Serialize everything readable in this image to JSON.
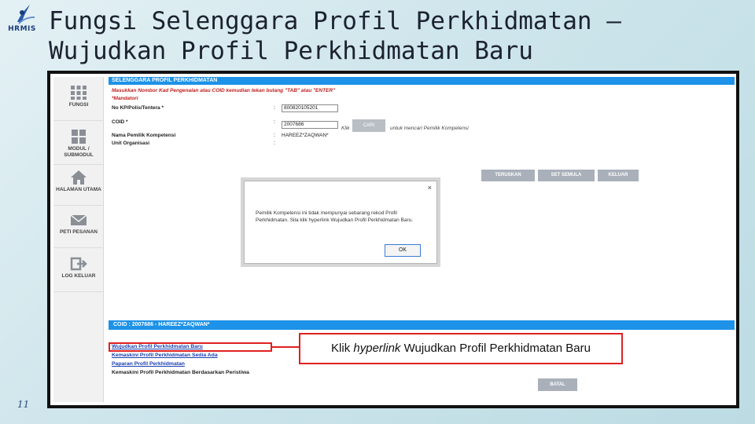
{
  "slide": {
    "logo_text": "HRMIS",
    "title": "Fungsi Selenggara Profil Perkhidmatan – Wujudkan Profil Perkhidmatan Baru",
    "page_number": "11"
  },
  "sidebar": {
    "items": [
      {
        "label": "FUNGSI",
        "icon": "grid-icon"
      },
      {
        "label": "MODUL / SUBMODUL",
        "icon": "modules-icon"
      },
      {
        "label": "HALAMAN UTAMA",
        "icon": "home-icon"
      },
      {
        "label": "PETI PESANAN",
        "icon": "mail-icon"
      },
      {
        "label": "LOG KELUAR",
        "icon": "logout-icon"
      }
    ]
  },
  "form": {
    "header": "SELENGGARA PROFIL PERKHIDMATAN",
    "instruction": "Masukkan Nombor Kad Pengenalan atau COID kemudian tekan butang \"TAB\" atau \"ENTER\"",
    "mandatory_note": "*Mandatori",
    "fields": {
      "kp_label": "No KP/Polis/Tentera *",
      "kp_value": "800820105201",
      "coid_label": "COID *",
      "coid_value": "2007686",
      "nama_label": "Nama Pemilik Kompetensi",
      "nama_value": "HAREEZ*ZAQWAN*",
      "unit_label": "Unit Organisasi"
    },
    "colon": ":",
    "cari_label": "CARI",
    "klik_prefix": "Klik",
    "klik_suffix": "untuk mencari Pemilik Kompetensi",
    "buttons": {
      "teruskan": "TERUSKAN",
      "set_semula": "SET SEMULA",
      "keluar": "KELUAR"
    }
  },
  "modal": {
    "close": "×",
    "message": "Pemilik Kompetensi ini tidak mempunyai sebarang rekod Profil Perkhidmatan. Sila klik hyperlink Wujudkan Profil Perkhidmatan Baru.",
    "ok_label": "OK"
  },
  "lower": {
    "coid_bar": "COID : 2007686 - HAREEZ*ZAQWAN*",
    "links": [
      "Wujudkan Profil Perkhidmatan Baru",
      "Kemaskini Profil Perkhidmatan Sedia Ada",
      "Paparan Profil Perkhidmatan"
    ],
    "plain_item": "Kemaskini Profil Perkhidmatan Berdasarkan Peristiwa",
    "batal_label": "BATAL",
    "callout_prefix": "Klik",
    "callout_italic": "hyperlink",
    "callout_suffix": "Wujudkan Profil Perkhidmatan Baru"
  },
  "colors": {
    "header_blue": "#1d92e8",
    "highlight_red": "#e02020",
    "link_blue": "#1a3fb0"
  }
}
